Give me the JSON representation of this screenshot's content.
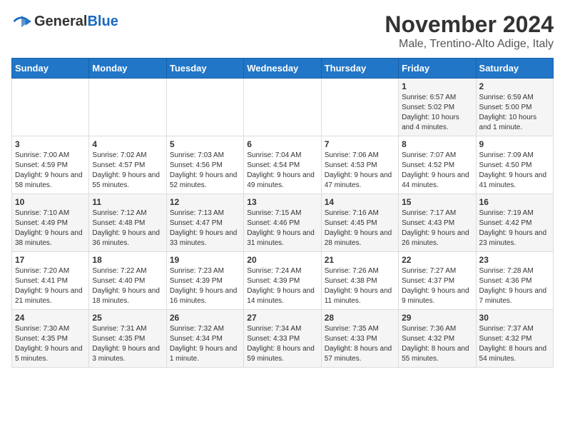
{
  "logo": {
    "text_general": "General",
    "text_blue": "Blue"
  },
  "title": "November 2024",
  "subtitle": "Male, Trentino-Alto Adige, Italy",
  "days_of_week": [
    "Sunday",
    "Monday",
    "Tuesday",
    "Wednesday",
    "Thursday",
    "Friday",
    "Saturday"
  ],
  "weeks": [
    [
      {
        "day": "",
        "content": ""
      },
      {
        "day": "",
        "content": ""
      },
      {
        "day": "",
        "content": ""
      },
      {
        "day": "",
        "content": ""
      },
      {
        "day": "",
        "content": ""
      },
      {
        "day": "1",
        "content": "Sunrise: 6:57 AM\nSunset: 5:02 PM\nDaylight: 10 hours and 4 minutes."
      },
      {
        "day": "2",
        "content": "Sunrise: 6:59 AM\nSunset: 5:00 PM\nDaylight: 10 hours and 1 minute."
      }
    ],
    [
      {
        "day": "3",
        "content": "Sunrise: 7:00 AM\nSunset: 4:59 PM\nDaylight: 9 hours and 58 minutes."
      },
      {
        "day": "4",
        "content": "Sunrise: 7:02 AM\nSunset: 4:57 PM\nDaylight: 9 hours and 55 minutes."
      },
      {
        "day": "5",
        "content": "Sunrise: 7:03 AM\nSunset: 4:56 PM\nDaylight: 9 hours and 52 minutes."
      },
      {
        "day": "6",
        "content": "Sunrise: 7:04 AM\nSunset: 4:54 PM\nDaylight: 9 hours and 49 minutes."
      },
      {
        "day": "7",
        "content": "Sunrise: 7:06 AM\nSunset: 4:53 PM\nDaylight: 9 hours and 47 minutes."
      },
      {
        "day": "8",
        "content": "Sunrise: 7:07 AM\nSunset: 4:52 PM\nDaylight: 9 hours and 44 minutes."
      },
      {
        "day": "9",
        "content": "Sunrise: 7:09 AM\nSunset: 4:50 PM\nDaylight: 9 hours and 41 minutes."
      }
    ],
    [
      {
        "day": "10",
        "content": "Sunrise: 7:10 AM\nSunset: 4:49 PM\nDaylight: 9 hours and 38 minutes."
      },
      {
        "day": "11",
        "content": "Sunrise: 7:12 AM\nSunset: 4:48 PM\nDaylight: 9 hours and 36 minutes."
      },
      {
        "day": "12",
        "content": "Sunrise: 7:13 AM\nSunset: 4:47 PM\nDaylight: 9 hours and 33 minutes."
      },
      {
        "day": "13",
        "content": "Sunrise: 7:15 AM\nSunset: 4:46 PM\nDaylight: 9 hours and 31 minutes."
      },
      {
        "day": "14",
        "content": "Sunrise: 7:16 AM\nSunset: 4:45 PM\nDaylight: 9 hours and 28 minutes."
      },
      {
        "day": "15",
        "content": "Sunrise: 7:17 AM\nSunset: 4:43 PM\nDaylight: 9 hours and 26 minutes."
      },
      {
        "day": "16",
        "content": "Sunrise: 7:19 AM\nSunset: 4:42 PM\nDaylight: 9 hours and 23 minutes."
      }
    ],
    [
      {
        "day": "17",
        "content": "Sunrise: 7:20 AM\nSunset: 4:41 PM\nDaylight: 9 hours and 21 minutes."
      },
      {
        "day": "18",
        "content": "Sunrise: 7:22 AM\nSunset: 4:40 PM\nDaylight: 9 hours and 18 minutes."
      },
      {
        "day": "19",
        "content": "Sunrise: 7:23 AM\nSunset: 4:39 PM\nDaylight: 9 hours and 16 minutes."
      },
      {
        "day": "20",
        "content": "Sunrise: 7:24 AM\nSunset: 4:39 PM\nDaylight: 9 hours and 14 minutes."
      },
      {
        "day": "21",
        "content": "Sunrise: 7:26 AM\nSunset: 4:38 PM\nDaylight: 9 hours and 11 minutes."
      },
      {
        "day": "22",
        "content": "Sunrise: 7:27 AM\nSunset: 4:37 PM\nDaylight: 9 hours and 9 minutes."
      },
      {
        "day": "23",
        "content": "Sunrise: 7:28 AM\nSunset: 4:36 PM\nDaylight: 9 hours and 7 minutes."
      }
    ],
    [
      {
        "day": "24",
        "content": "Sunrise: 7:30 AM\nSunset: 4:35 PM\nDaylight: 9 hours and 5 minutes."
      },
      {
        "day": "25",
        "content": "Sunrise: 7:31 AM\nSunset: 4:35 PM\nDaylight: 9 hours and 3 minutes."
      },
      {
        "day": "26",
        "content": "Sunrise: 7:32 AM\nSunset: 4:34 PM\nDaylight: 9 hours and 1 minute."
      },
      {
        "day": "27",
        "content": "Sunrise: 7:34 AM\nSunset: 4:33 PM\nDaylight: 8 hours and 59 minutes."
      },
      {
        "day": "28",
        "content": "Sunrise: 7:35 AM\nSunset: 4:33 PM\nDaylight: 8 hours and 57 minutes."
      },
      {
        "day": "29",
        "content": "Sunrise: 7:36 AM\nSunset: 4:32 PM\nDaylight: 8 hours and 55 minutes."
      },
      {
        "day": "30",
        "content": "Sunrise: 7:37 AM\nSunset: 4:32 PM\nDaylight: 8 hours and 54 minutes."
      }
    ]
  ]
}
